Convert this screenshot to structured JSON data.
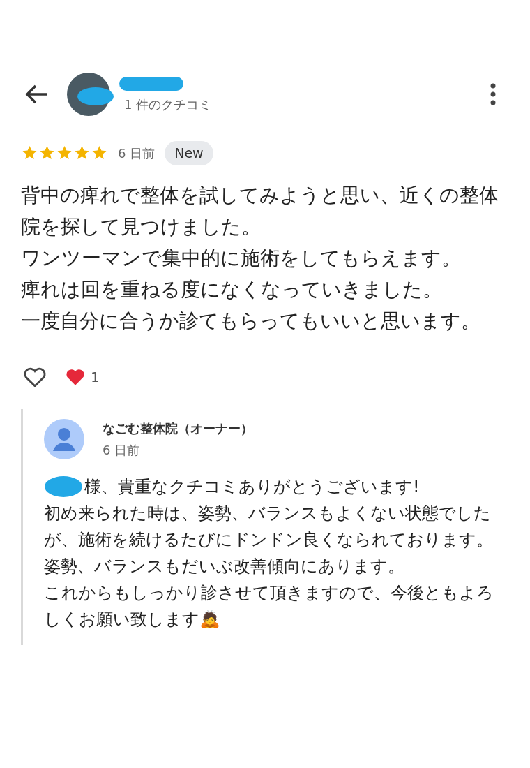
{
  "header": {
    "review_count": "1 件のクチコミ"
  },
  "review": {
    "stars": 5,
    "time": "6 日前",
    "badge": "New",
    "lines": [
      "背中の痺れで整体を試してみようと思い、近くの整体院を探して見つけました。",
      "ワンツーマンで集中的に施術をしてもらえます。",
      "痺れは回を重ねる度になくなっていきました。",
      "一度自分に合うか診てもらってもいいと思います。"
    ],
    "liked": false,
    "reaction_count": "1"
  },
  "owner_reply": {
    "name": "なごむ整体院（オーナー）",
    "time": "6 日前",
    "lines": [
      "様、貴重なクチコミありがとうございます!",
      "初め来られた時は、姿勢、バランスもよくない状態でしたが、施術を続けるたびにドンドン良くなられております。",
      "姿勢、バランスもだいぶ改善傾向にあります。",
      "これからもしっかり診させて頂きますので、今後ともよろしくお願い致します🙇"
    ]
  }
}
